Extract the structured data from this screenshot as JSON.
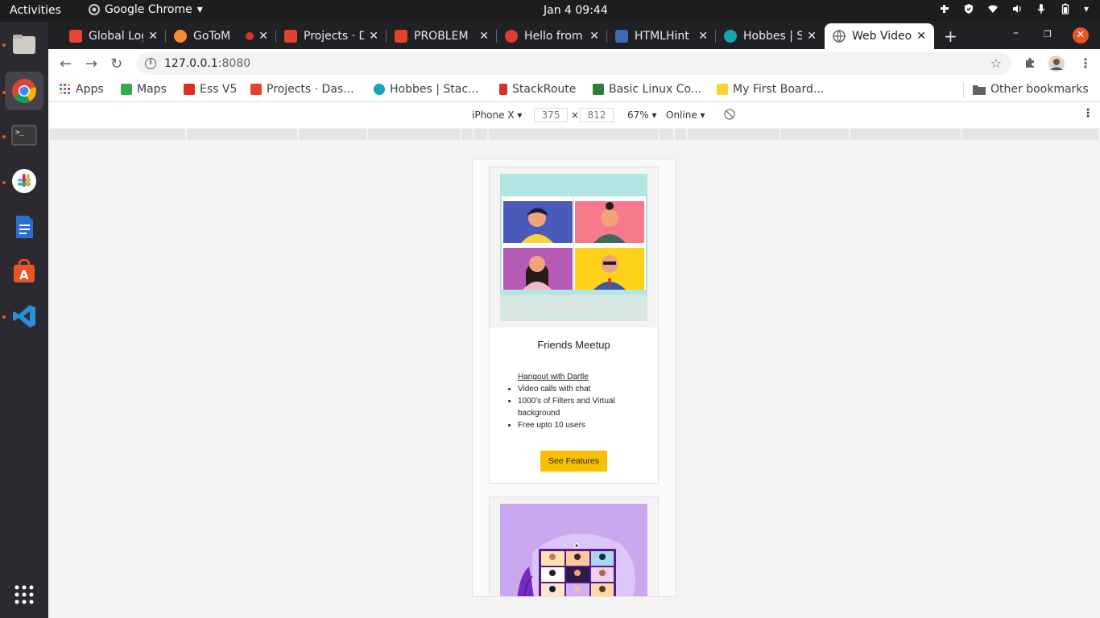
{
  "topbar": {
    "activities": "Activities",
    "app_name": "Google Chrome",
    "clock": "Jan 4  09:44"
  },
  "tabs": [
    {
      "title": "Global Log",
      "color": "#ea4335"
    },
    {
      "title": "GoToM",
      "color": "#f68d2e"
    },
    {
      "title": "Projects · D",
      "color": "#e24329"
    },
    {
      "title": "PROBLEM",
      "color": "#e24329"
    },
    {
      "title": "Hello from",
      "color": "#e53935"
    },
    {
      "title": "HTMLHint",
      "color": "#3b6bb5"
    },
    {
      "title": "Hobbes | S",
      "color": "#17a2b8"
    },
    {
      "title": "Web Video",
      "color": "#5f6368"
    }
  ],
  "toolbar": {
    "url_host": "127.0.0.1",
    "url_port": ":8080"
  },
  "bookmarks": [
    {
      "label": "Apps",
      "color": "#4285f4"
    },
    {
      "label": "Maps",
      "color": "#34a853"
    },
    {
      "label": "Ess V5",
      "color": "#d93025"
    },
    {
      "label": "Projects · Das...",
      "color": "#e24329"
    },
    {
      "label": "Hobbes | Stac...",
      "color": "#17a2b8"
    },
    {
      "label": "StackRoute",
      "color": "#d93025"
    },
    {
      "label": "Basic Linux Co...",
      "color": "#2e7d32"
    },
    {
      "label": "My First Board...",
      "color": "#ffd02f"
    },
    {
      "label": "Other bookmarks",
      "color": "#5f6368"
    }
  ],
  "device_toolbar": {
    "device": "iPhone X",
    "width": "375",
    "times": "×",
    "height": "812",
    "zoom": "67%",
    "network": "Online"
  },
  "cards": [
    {
      "title": "Friends Meetup",
      "list_head": "Hangout with Dartle",
      "items": [
        "Video calls with chat",
        "1000's of Filters and Virtual background",
        "Free upto 10 users"
      ],
      "button": "See Features"
    }
  ],
  "colors": {
    "accent_button": "#f9c000",
    "card1_bg": "#b3e5e3",
    "card2_bg": "#c9a8f0"
  }
}
